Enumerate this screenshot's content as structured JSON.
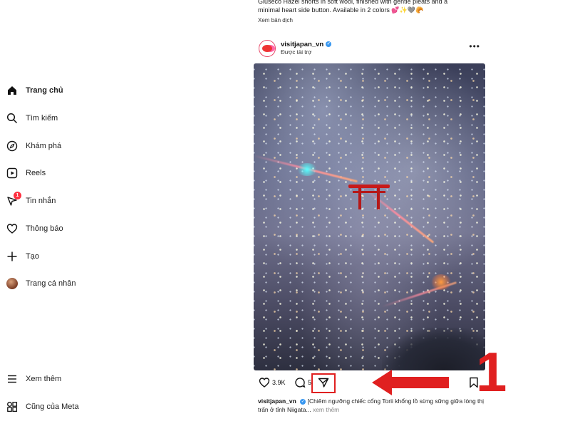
{
  "sidebar": {
    "items": [
      {
        "label": "Trang chủ",
        "icon": "home-icon"
      },
      {
        "label": "Tìm kiếm",
        "icon": "search-icon"
      },
      {
        "label": "Khám phá",
        "icon": "compass-icon"
      },
      {
        "label": "Reels",
        "icon": "reels-icon"
      },
      {
        "label": "Tin nhắn",
        "icon": "messenger-icon",
        "badge": "1"
      },
      {
        "label": "Thông báo",
        "icon": "heart-icon"
      },
      {
        "label": "Tạo",
        "icon": "plus-icon"
      },
      {
        "label": "Trang cá nhân",
        "icon": "profile-avatar"
      },
      {
        "label": "Xem thêm",
        "icon": "menu-icon"
      },
      {
        "label": "Cũng của Meta",
        "icon": "meta-apps-icon"
      }
    ]
  },
  "feed": {
    "previous_post": {
      "caption_line1": "Giuseco Hazel shorts in soft wool, finished with gentle pleats and a",
      "caption_line2": "minimal heart side button. Available in 2 colors 💕✨🩶🥐",
      "see_translation": "Xem bản dịch"
    },
    "post": {
      "username": "visitjapan_vn",
      "sponsored": "Được tài trợ",
      "more": "•••",
      "likes": "3.9K",
      "comments": "5",
      "caption_user": "visitjapan_vn",
      "caption_text": "[Chiêm ngưỡng chiếc cổng Torii khổng lồ sừng sững giữa lòng thị trấn ở tỉnh Niigata...",
      "caption_more": "xem thêm"
    }
  },
  "annotation": {
    "step_number": "1",
    "color": "#e02020"
  }
}
